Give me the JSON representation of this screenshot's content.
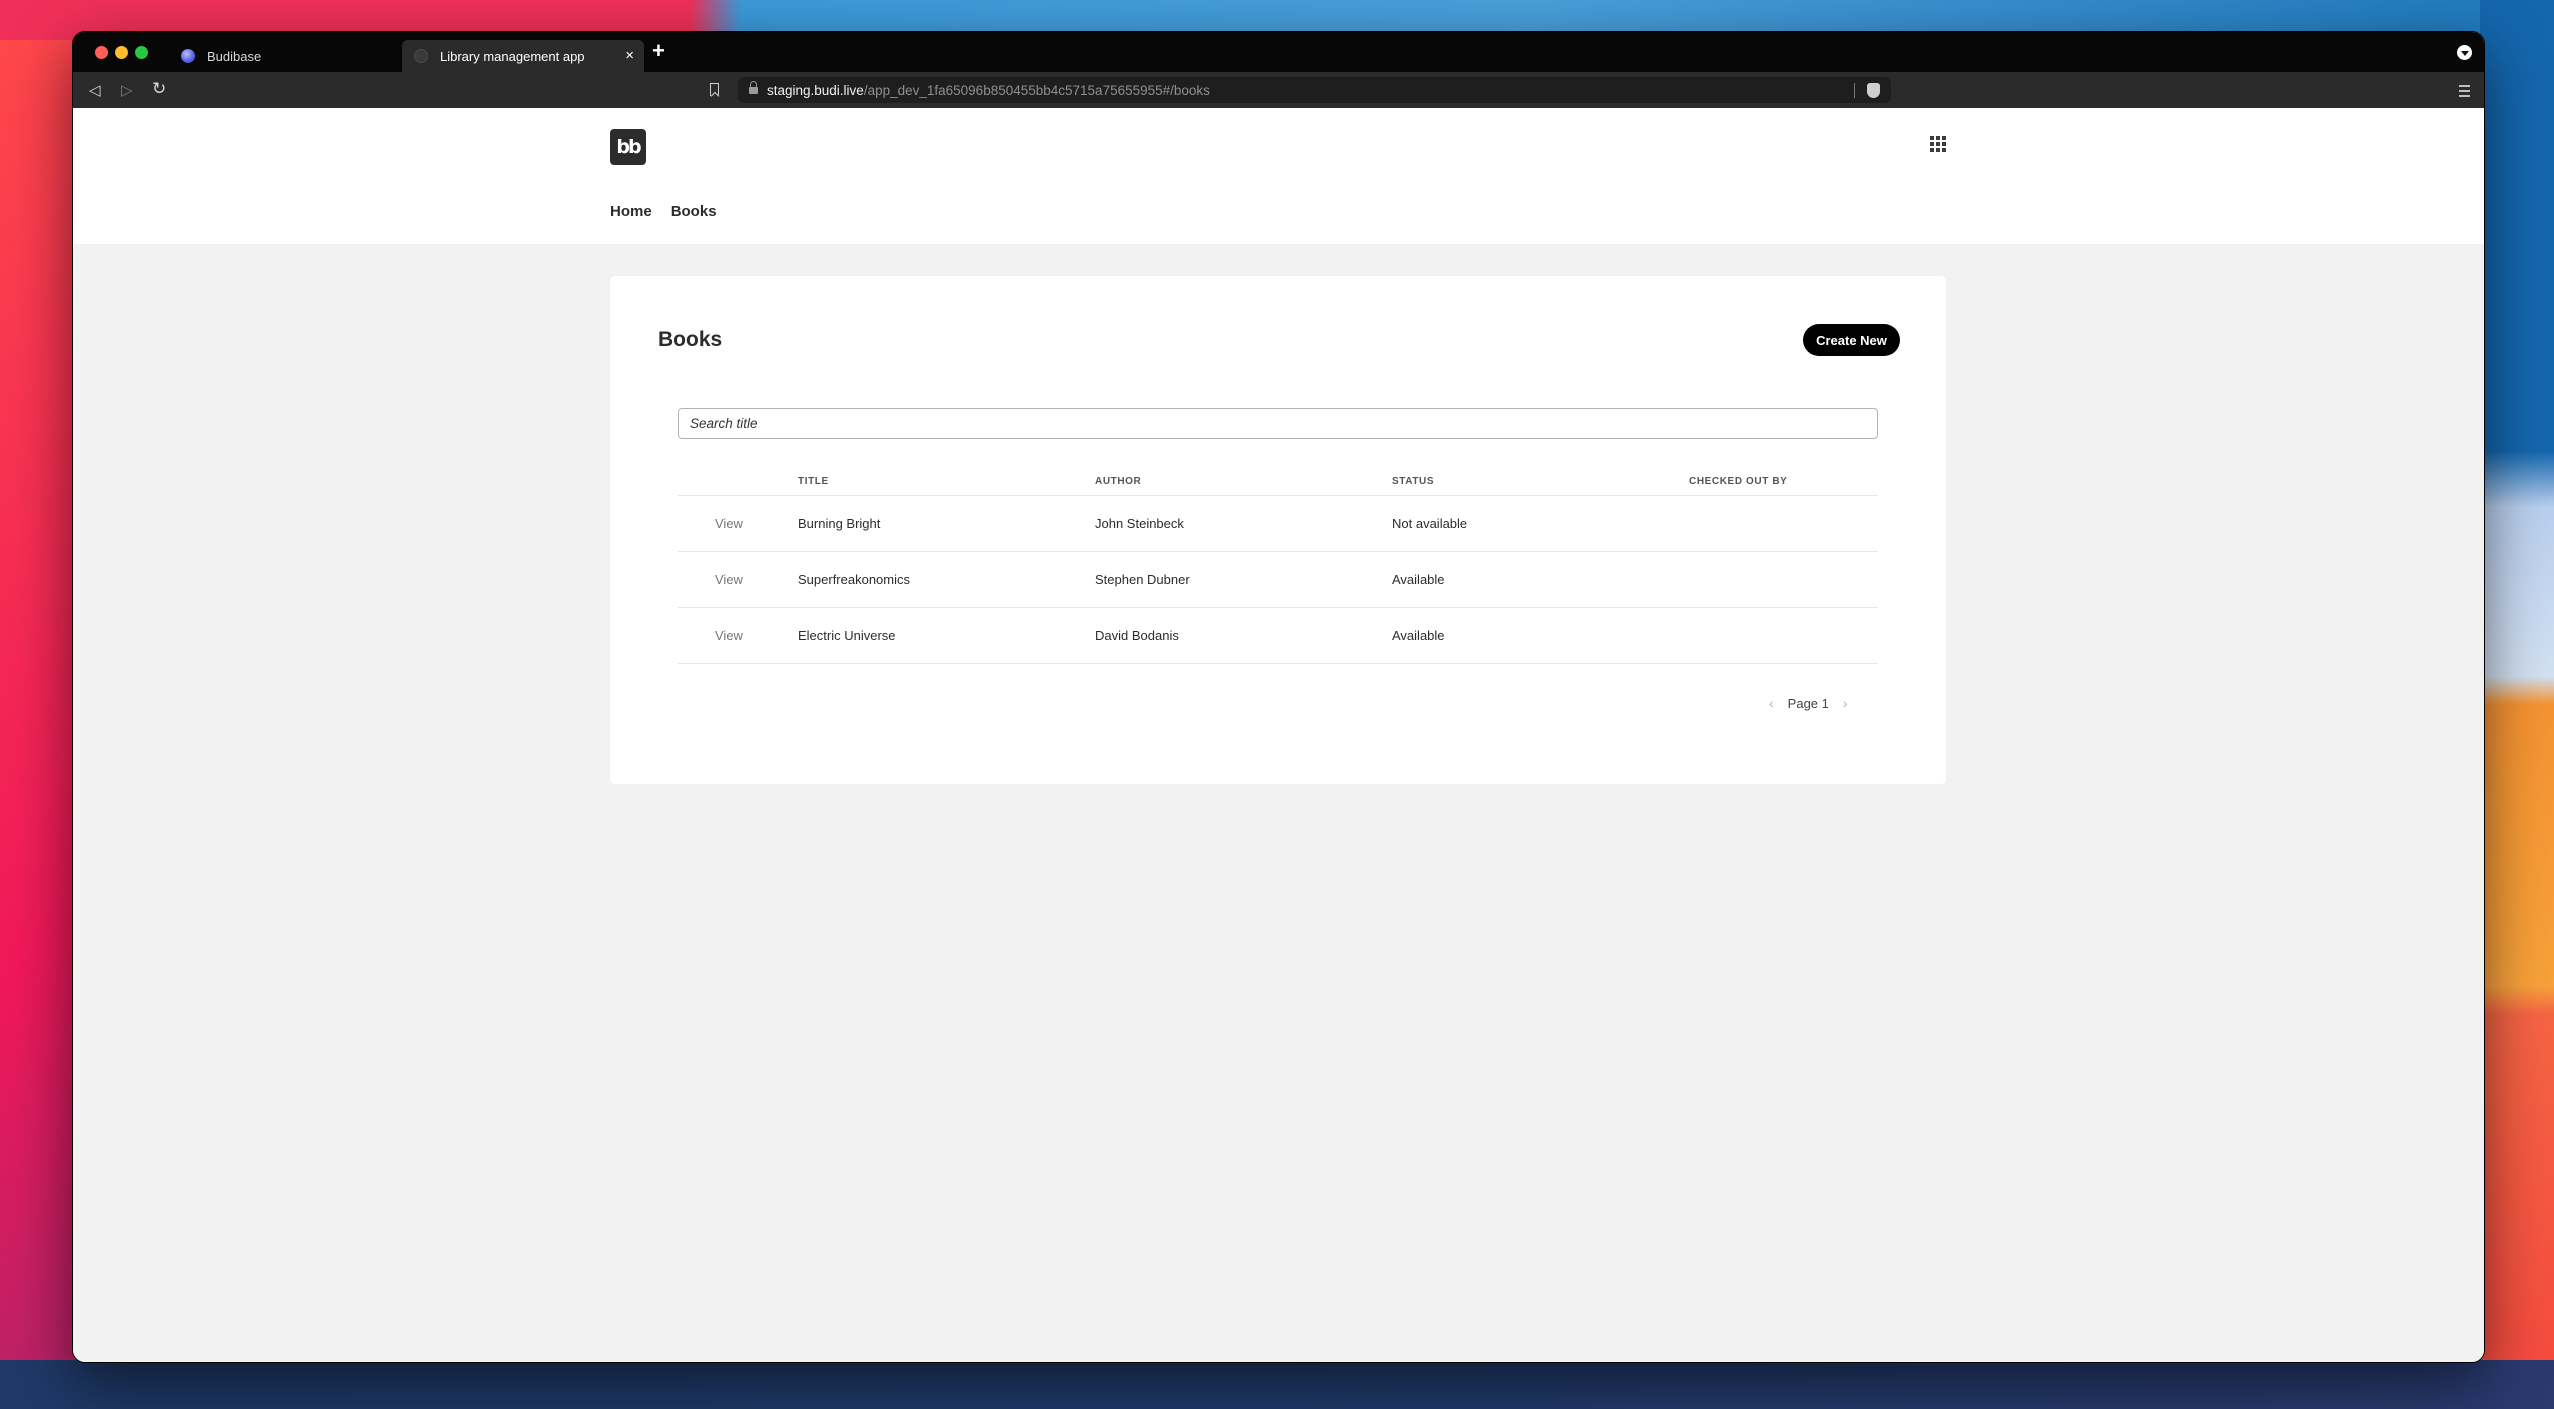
{
  "browser": {
    "tabs": [
      {
        "label": "Budibase",
        "favicon": "budibase-favicon",
        "active": false
      },
      {
        "label": "Library management app",
        "favicon": "globe-favicon",
        "active": true
      }
    ],
    "new_tab_symbol": "+",
    "close_symbol": "×",
    "url_host": "staging.budi.live",
    "url_path": "/app_dev_1fa65096b850455bb4c5715a75655955#/books",
    "nav": {
      "back": "◁",
      "forward": "▷",
      "reload": "↻"
    }
  },
  "app": {
    "logo_text": "bb",
    "nav": [
      {
        "label": "Home"
      },
      {
        "label": "Books"
      }
    ]
  },
  "page": {
    "title": "Books",
    "create_button": "Create New",
    "search_placeholder": "Search title",
    "search_value": "",
    "table": {
      "columns": [
        "",
        "TITLE",
        "AUTHOR",
        "STATUS",
        "CHECKED OUT BY"
      ],
      "rows": [
        {
          "action": "View",
          "title": "Burning Bright",
          "author": "John Steinbeck",
          "status": "Not available",
          "checked_out_by": ""
        },
        {
          "action": "View",
          "title": "Superfreakonomics",
          "author": "Stephen Dubner",
          "status": "Available",
          "checked_out_by": ""
        },
        {
          "action": "View",
          "title": "Electric Universe",
          "author": "David Bodanis",
          "status": "Available",
          "checked_out_by": ""
        }
      ]
    },
    "pagination": {
      "label": "Page 1",
      "prev": "‹",
      "next": "›"
    }
  },
  "colors": {
    "primary_button": "#000000",
    "page_background": "#f2f2f2",
    "card_background": "#ffffff"
  }
}
